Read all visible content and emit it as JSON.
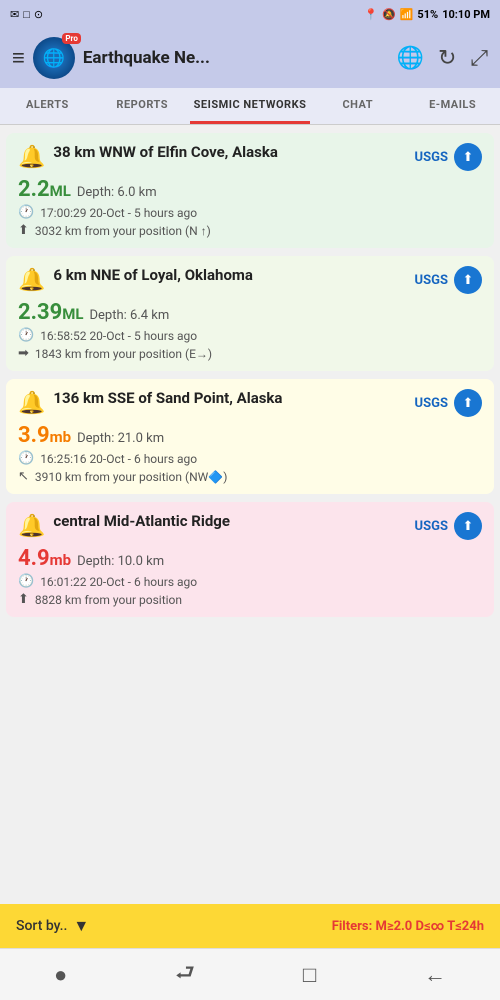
{
  "statusBar": {
    "leftIcons": [
      "✉",
      "□",
      "◎"
    ],
    "signal": "📍",
    "battery": "51%",
    "time": "10:10 PM"
  },
  "header": {
    "title": "Earthquake Ne...",
    "menuIcon": "≡",
    "globeIcon": "🌐",
    "refreshIcon": "↻",
    "expandIcon": "⤢"
  },
  "tabs": [
    {
      "label": "ALERTS",
      "active": false
    },
    {
      "label": "REPORTS",
      "active": false
    },
    {
      "label": "SEISMIC NETWORKS",
      "active": true
    },
    {
      "label": "CHAT",
      "active": false
    },
    {
      "label": "E-MAILS",
      "active": false
    }
  ],
  "earthquakes": [
    {
      "id": "eq1",
      "colorClass": "green",
      "location": "38 km WNW of Elfin Cove, Alaska",
      "source": "USGS",
      "magnitude": "2.2",
      "magnitudeUnit": "ML",
      "magnitudeColor": "green-mag",
      "depth": "Depth: 6.0 km",
      "time": "17:00:29 20-Oct - 5 hours ago",
      "distance": "3032 km from your position (N ↑)"
    },
    {
      "id": "eq2",
      "colorClass": "light-green",
      "location": "6 km NNE of Loyal, Oklahoma",
      "source": "USGS",
      "magnitude": "2.39",
      "magnitudeUnit": "ML",
      "magnitudeColor": "green-mag",
      "depth": "Depth: 6.4 km",
      "time": "16:58:52 20-Oct - 5 hours ago",
      "distance": "1843 km from your position (E→)"
    },
    {
      "id": "eq3",
      "colorClass": "yellow",
      "location": "136 km SSE of Sand Point, Alaska",
      "source": "USGS",
      "magnitude": "3.9",
      "magnitudeUnit": "mb",
      "magnitudeColor": "orange-mag",
      "depth": "Depth: 21.0 km",
      "time": "16:25:16 20-Oct - 6 hours ago",
      "distance": "3910 km from your position (NW🔷)"
    },
    {
      "id": "eq4",
      "colorClass": "red",
      "location": "central Mid-Atlantic Ridge",
      "source": "USGS",
      "magnitude": "4.9",
      "magnitudeUnit": "mb",
      "magnitudeColor": "red-mag",
      "depth": "Depth: 10.0 km",
      "time": "16:01:22 20-Oct - 6 hours ago",
      "distance": "8828 km from your position"
    }
  ],
  "bottomBar": {
    "sortLabel": "Sort by..",
    "filterLabel": "Filters: M≥",
    "filterMag": "2.0",
    "filterRest": " D≤∞ T≤24h"
  },
  "navBar": {
    "dotIcon": "●",
    "squigglyIcon": "⮐",
    "squareIcon": "□",
    "backIcon": "←"
  }
}
